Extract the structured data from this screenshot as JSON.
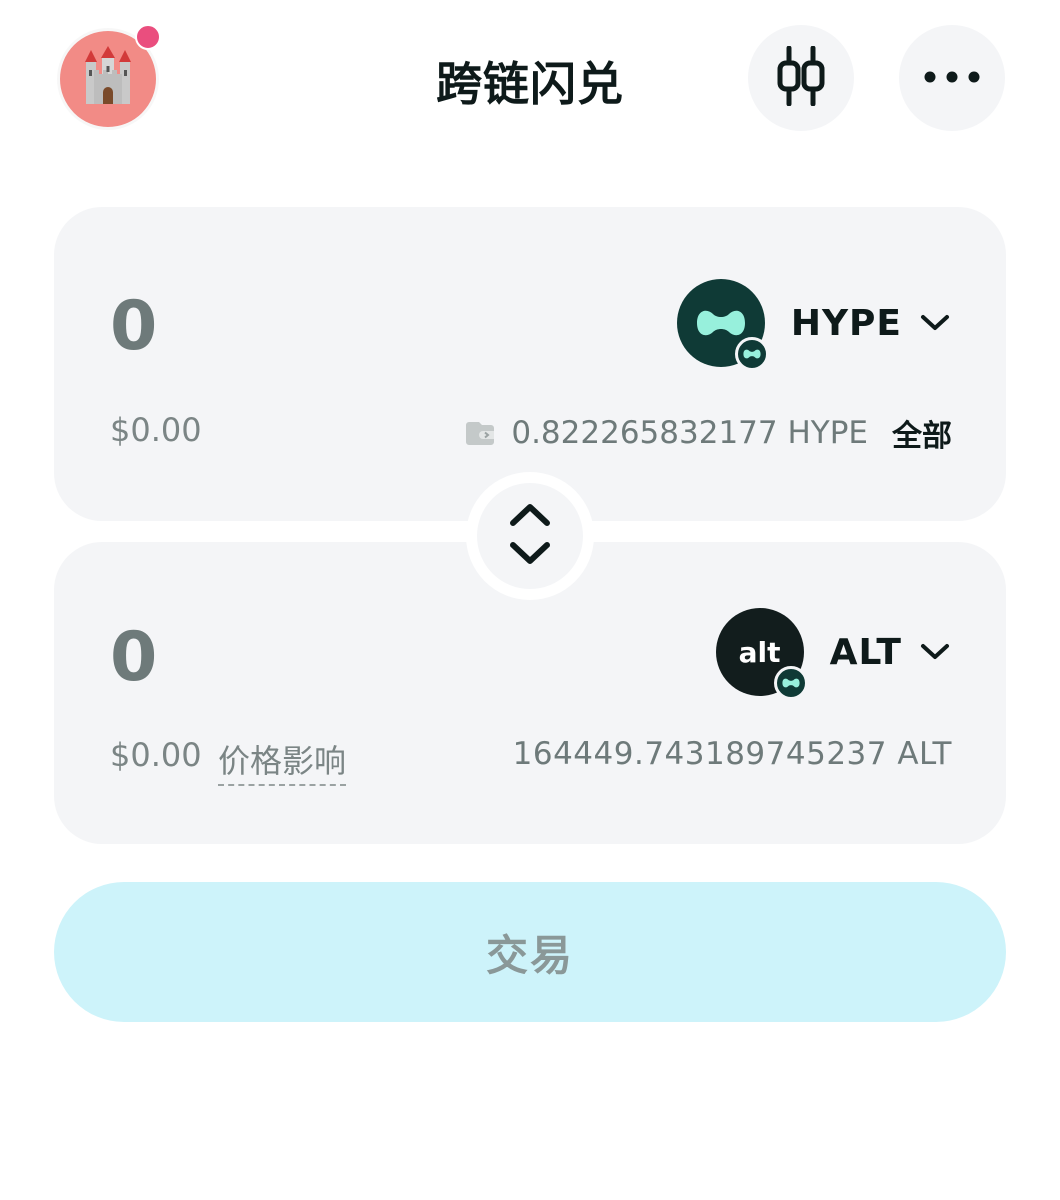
{
  "header": {
    "title": "跨链闪兑",
    "avatar_icon": "castle-icon",
    "chart_icon": "candlestick-chart-icon",
    "more_icon": "more-dots-icon"
  },
  "from": {
    "amount": "0",
    "usd_value": "$0.00",
    "token_symbol": "HYPE",
    "balance": "0.822265832177 HYPE",
    "max_label": "全部"
  },
  "to": {
    "amount": "0",
    "usd_value": "$0.00",
    "price_impact_label": "价格影响",
    "token_symbol": "ALT",
    "token_logo_text": "alt",
    "balance": "164449.743189745237 ALT"
  },
  "trade_button_label": "交易",
  "colors": {
    "panel_bg": "#f4f5f7",
    "trade_button_bg": "#cdf3fa",
    "hype_mint": "#97f0dc",
    "notification_dot": "#ea4e7e"
  }
}
